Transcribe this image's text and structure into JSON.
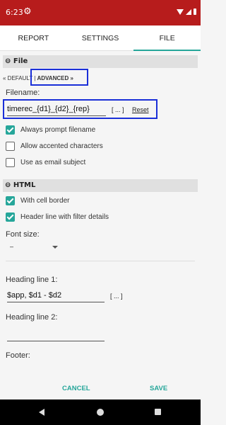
{
  "status": {
    "time": "6:23"
  },
  "tabs": [
    {
      "label": "REPORT"
    },
    {
      "label": "SETTINGS"
    },
    {
      "label": "FILE"
    }
  ],
  "file_section": {
    "header": "⊖ File",
    "default_link": "« DEFAULT",
    "separator": "|",
    "advanced_link": "ADVANCED »",
    "filename_label": "Filename:",
    "filename_value": "timerec_{d1}_{d2}_{rep}",
    "picker_button": "[ ... ]",
    "reset_button": "Reset",
    "options": [
      {
        "label": "Always prompt filename",
        "checked": true
      },
      {
        "label": "Allow accented characters",
        "checked": false
      },
      {
        "label": "Use as email subject",
        "checked": false
      }
    ]
  },
  "html_section": {
    "header": "⊖ HTML",
    "options": [
      {
        "label": "With cell border",
        "checked": true
      },
      {
        "label": "Header line with filter details",
        "checked": true
      }
    ],
    "font_size_label": "Font size:",
    "font_size_value": "–",
    "heading1_label": "Heading line 1:",
    "heading1_value": "$app, $d1 - $d2",
    "heading1_picker": "[ ... ]",
    "heading2_label": "Heading line 2:",
    "heading2_value": "",
    "footer_label": "Footer:"
  },
  "actions": {
    "cancel": "CANCEL",
    "save": "SAVE"
  },
  "colors": {
    "status_bar": "#b71c1c",
    "accent": "#26a69a",
    "highlight_box": "#1a2fd8"
  }
}
